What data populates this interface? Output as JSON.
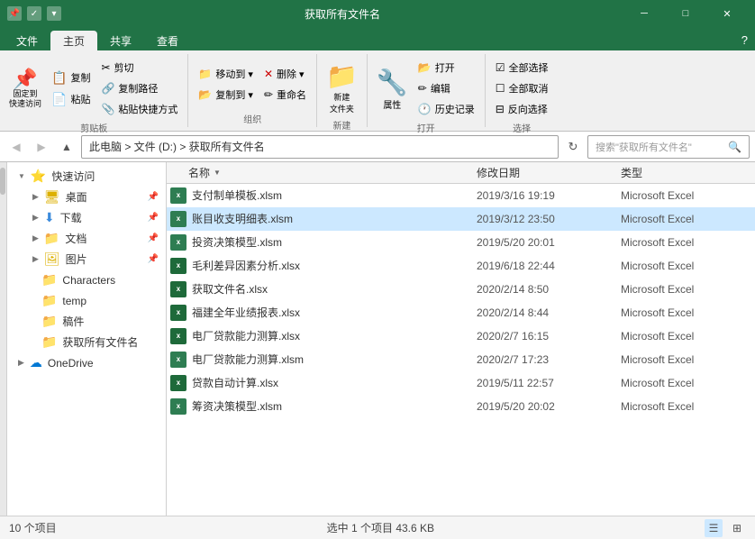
{
  "titleBar": {
    "title": "获取所有文件名",
    "icons": [
      "pin-icon",
      "checkmark-icon",
      "dropdown-icon"
    ],
    "controls": [
      "minimize",
      "maximize",
      "close"
    ]
  },
  "ribbonTabs": [
    {
      "label": "文件",
      "active": false
    },
    {
      "label": "主页",
      "active": true
    },
    {
      "label": "共享",
      "active": false
    },
    {
      "label": "查看",
      "active": false
    }
  ],
  "ribbonGroups": [
    {
      "label": "剪贴板",
      "buttons": [
        {
          "icon": "📌",
          "label": "固定到\n快速访问",
          "size": "big"
        },
        {
          "icon": "📋",
          "label": "复制",
          "size": "med"
        },
        {
          "icon": "📄",
          "label": "粘贴",
          "size": "med"
        },
        {
          "icon": "✂",
          "label": "剪切",
          "size": "small"
        },
        {
          "icon": "🔗",
          "label": "复制路径",
          "size": "small"
        },
        {
          "icon": "📌",
          "label": "粘贴快捷方式",
          "size": "small"
        }
      ]
    },
    {
      "label": "组织",
      "buttons": [
        {
          "icon": "→",
          "label": "移动到",
          "size": "small"
        },
        {
          "icon": "❌",
          "label": "删除",
          "size": "small"
        },
        {
          "icon": "→",
          "label": "复制到",
          "size": "small"
        },
        {
          "icon": "✏",
          "label": "重命名",
          "size": "small"
        }
      ]
    },
    {
      "label": "新建",
      "buttons": [
        {
          "icon": "📁",
          "label": "新建\n文件夹",
          "size": "big"
        }
      ]
    },
    {
      "label": "打开",
      "buttons": [
        {
          "icon": "✔",
          "label": "属性",
          "size": "big"
        },
        {
          "icon": "📂",
          "label": "打开",
          "size": "small"
        },
        {
          "icon": "✏",
          "label": "编辑",
          "size": "small"
        },
        {
          "icon": "📜",
          "label": "历史记录",
          "size": "small"
        }
      ]
    },
    {
      "label": "选择",
      "buttons": [
        {
          "icon": "☑",
          "label": "全部选择",
          "size": "small"
        },
        {
          "icon": "☐",
          "label": "全部取消",
          "size": "small"
        },
        {
          "icon": "⊟",
          "label": "反向选择",
          "size": "small"
        }
      ]
    }
  ],
  "addressBar": {
    "path": "此电脑 > 文件 (D:) > 获取所有文件名",
    "searchPlaceholder": "搜索\"获取所有文件名\"",
    "searchIcon": "🔍"
  },
  "sidebar": {
    "items": [
      {
        "label": "快速访问",
        "icon": "star",
        "special": true,
        "expanded": true
      },
      {
        "label": "桌面",
        "icon": "folder",
        "indent": 1,
        "hasArrow": true
      },
      {
        "label": "下载",
        "icon": "folder-down",
        "indent": 1,
        "hasArrow": true
      },
      {
        "label": "文档",
        "icon": "folder",
        "indent": 1,
        "hasArrow": true
      },
      {
        "label": "图片",
        "icon": "folder",
        "indent": 1,
        "hasArrow": true
      },
      {
        "label": "Characters",
        "icon": "folder",
        "indent": 1
      },
      {
        "label": "temp",
        "icon": "folder",
        "indent": 1
      },
      {
        "label": "稿件",
        "icon": "folder",
        "indent": 1
      },
      {
        "label": "获取所有文件名",
        "icon": "folder",
        "indent": 1
      },
      {
        "label": "OneDrive",
        "icon": "cloud",
        "special": true
      }
    ]
  },
  "fileList": {
    "columns": [
      {
        "label": "名称",
        "key": "name"
      },
      {
        "label": "修改日期",
        "key": "date"
      },
      {
        "label": "类型",
        "key": "type"
      }
    ],
    "files": [
      {
        "name": "支付制单模板.xlsm",
        "date": "2019/3/16 19:19",
        "type": "Microsoft Excel",
        "ext": "xlsm",
        "selected": false
      },
      {
        "name": "账目收支明细表.xlsm",
        "date": "2019/3/12 23:50",
        "type": "Microsoft Excel",
        "ext": "xlsm",
        "selected": true
      },
      {
        "name": "投资决策模型.xlsm",
        "date": "2019/5/20 20:01",
        "type": "Microsoft Excel",
        "ext": "xlsm",
        "selected": false
      },
      {
        "name": "毛利差异因素分析.xlsx",
        "date": "2019/6/18 22:44",
        "type": "Microsoft Excel",
        "ext": "xlsx",
        "selected": false
      },
      {
        "name": "获取文件名.xlsx",
        "date": "2020/2/14 8:50",
        "type": "Microsoft Excel",
        "ext": "xlsx",
        "selected": false
      },
      {
        "name": "福建全年业绩报表.xlsx",
        "date": "2020/2/14 8:44",
        "type": "Microsoft Excel",
        "ext": "xlsx",
        "selected": false
      },
      {
        "name": "电厂贷款能力测算.xlsx",
        "date": "2020/2/7 16:15",
        "type": "Microsoft Excel",
        "ext": "xlsx",
        "selected": false
      },
      {
        "name": "电厂贷款能力测算.xlsm",
        "date": "2020/2/7 17:23",
        "type": "Microsoft Excel",
        "ext": "xlsm",
        "selected": false
      },
      {
        "name": "贷款自动计算.xlsx",
        "date": "2019/5/11 22:57",
        "type": "Microsoft Excel",
        "ext": "xlsx",
        "selected": false
      },
      {
        "name": "筹资决策模型.xlsm",
        "date": "2019/5/20 20:02",
        "type": "Microsoft Excel",
        "ext": "xlsm",
        "selected": false
      }
    ]
  },
  "statusBar": {
    "itemCount": "10 个项目",
    "selectedInfo": "选中 1 个项目  43.6 KB",
    "viewButtons": [
      "details-view",
      "large-icon-view"
    ]
  }
}
